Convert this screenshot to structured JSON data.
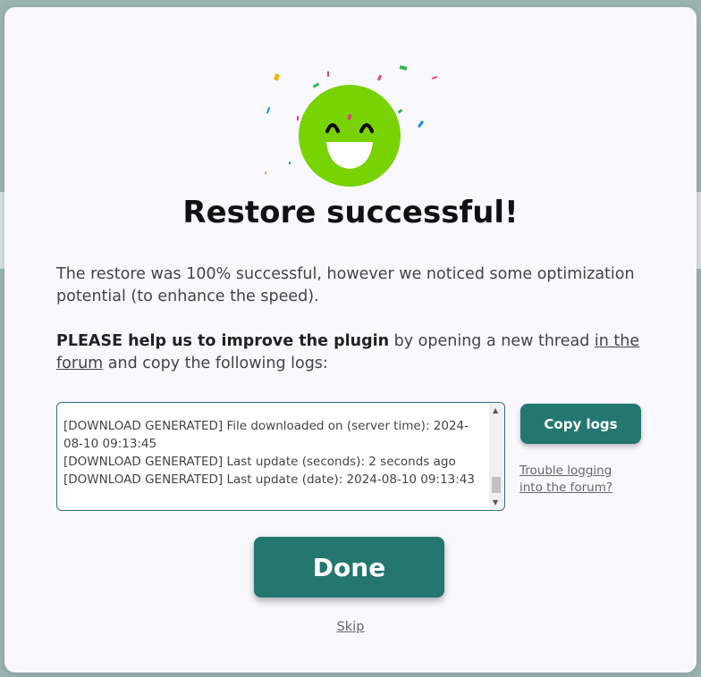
{
  "dialog": {
    "title": "Restore successful!",
    "message": "The restore was 100% successful, however we noticed some optimization potential (to enhance the speed).",
    "help_bold": "PLEASE help us to improve the plugin",
    "help_middle": " by opening a new thread ",
    "forum_link": "in the forum",
    "help_end": " and copy the following logs:",
    "logs": "[DOWNLOAD GENERATED] File downloaded on (server time): 2024-08-10 09:13:45\n[DOWNLOAD GENERATED] Last update (seconds): 2 seconds ago\n[DOWNLOAD GENERATED] Last update (date): 2024-08-10 09:13:43",
    "copy_logs_label": "Copy logs",
    "trouble_label": "Trouble logging into the forum?",
    "done_label": "Done",
    "skip_label": "Skip"
  },
  "colors": {
    "accent": "#23776f",
    "smiley": "#77d301",
    "overlay": "#9bb4b2"
  },
  "icons": {
    "illustration": "happy-smiley-icon",
    "decoration": "confetti-icon"
  }
}
